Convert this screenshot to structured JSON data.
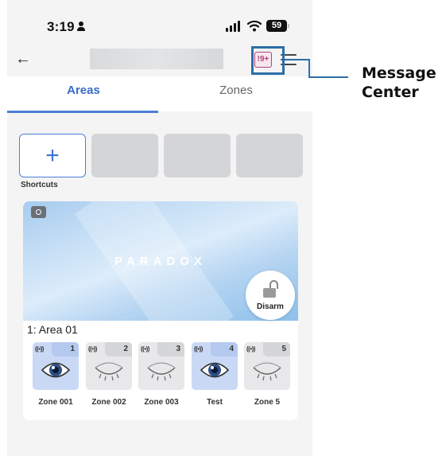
{
  "status_bar": {
    "time": "3:19",
    "battery": "59"
  },
  "header": {
    "message_badge": "!9+"
  },
  "tabs": [
    {
      "label": "Areas",
      "active": true
    },
    {
      "label": "Zones",
      "active": false
    }
  ],
  "shortcuts": {
    "add_symbol": "+",
    "label": "Shortcuts"
  },
  "area": {
    "brand": "PARADOX",
    "action_label": "Disarm",
    "name": "1: Area 01",
    "zones": [
      {
        "number": "1",
        "label": "Zone 001",
        "state": "open",
        "signal": "((•))"
      },
      {
        "number": "2",
        "label": "Zone 002",
        "state": "closed",
        "signal": "((•))"
      },
      {
        "number": "3",
        "label": "Zone 003",
        "state": "closed",
        "signal": "((•))"
      },
      {
        "number": "4",
        "label": "Test",
        "state": "open",
        "signal": "((•))"
      },
      {
        "number": "5",
        "label": "Zone 5",
        "state": "closed",
        "signal": "((•))"
      }
    ]
  },
  "annotation": {
    "line1": "Message",
    "line2": "Center",
    "color": "#2c6fa7"
  },
  "colors": {
    "accent": "#4a7fd6",
    "badge": "#b0457a"
  }
}
